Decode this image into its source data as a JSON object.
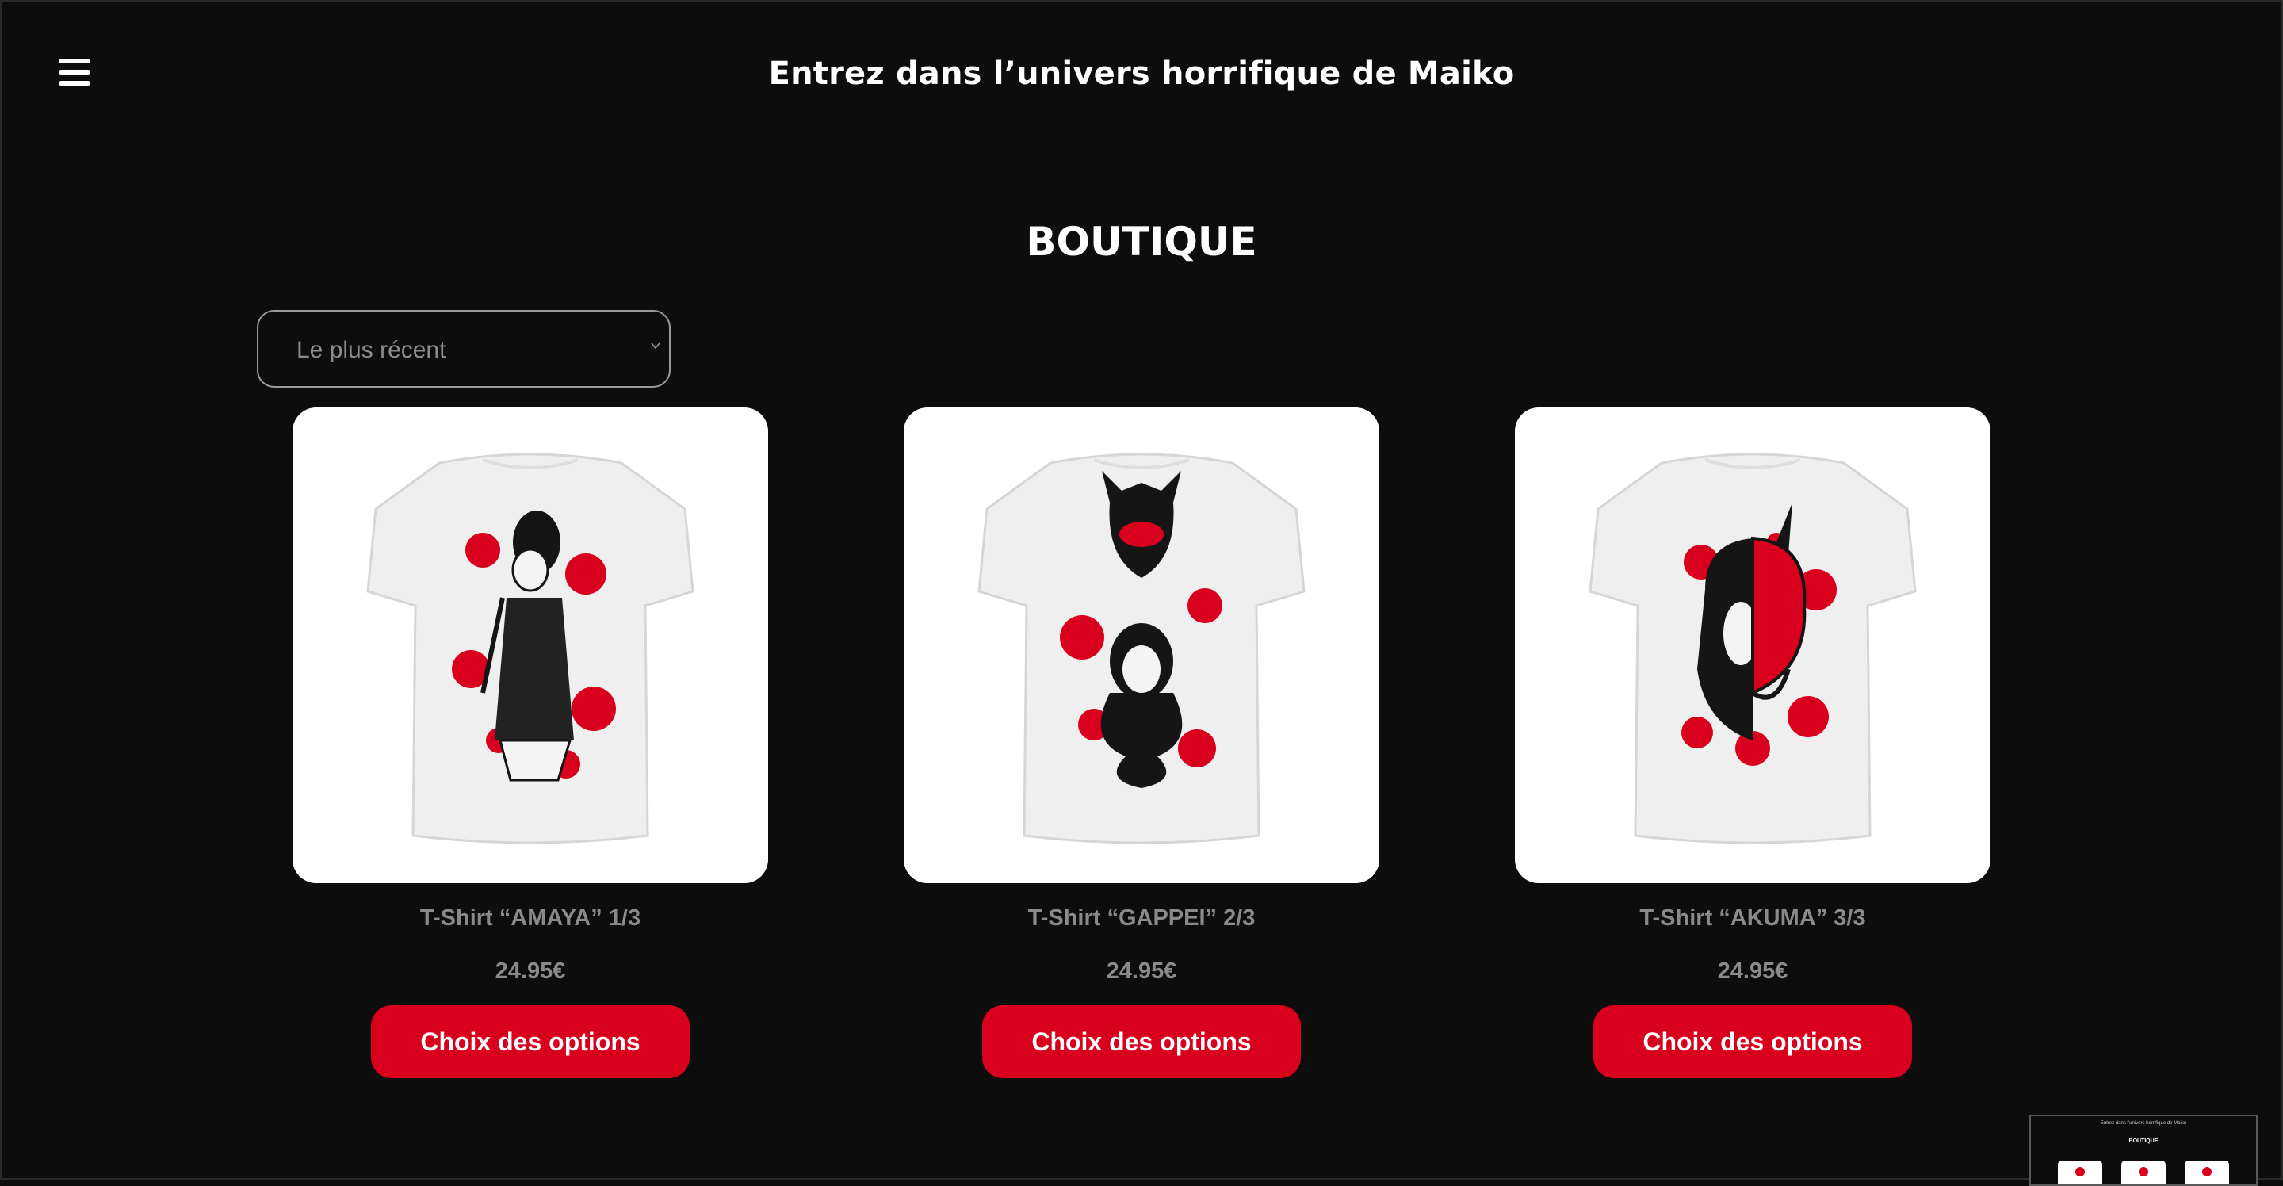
{
  "header": {
    "menu_icon": "hamburger-menu-icon",
    "site_title": "Entrez dans l’univers horrifique de Maiko"
  },
  "page": {
    "title": "BOUTIQUE"
  },
  "sort": {
    "selected": "Le plus récent",
    "icon": "chevron-down-icon"
  },
  "products": [
    {
      "name": "T-Shirt “AMAYA” 1/3",
      "price": "24.95€",
      "button_label": "Choix des options",
      "image_icon": "tshirt-amaya-image"
    },
    {
      "name": "T-Shirt “GAPPEI” 2/3",
      "price": "24.95€",
      "button_label": "Choix des options",
      "image_icon": "tshirt-gappei-image"
    },
    {
      "name": "T-Shirt “AKUMA” 3/3",
      "price": "24.95€",
      "button_label": "Choix des options",
      "image_icon": "tshirt-akuma-image"
    }
  ],
  "mini_preview": {
    "title": "Entrez dans l’univers horrifique de Maiko",
    "heading": "BOUTIQUE"
  },
  "colors": {
    "background": "#0d0d0d",
    "accent": "#d8001c",
    "muted_text": "#8a8a8a"
  }
}
